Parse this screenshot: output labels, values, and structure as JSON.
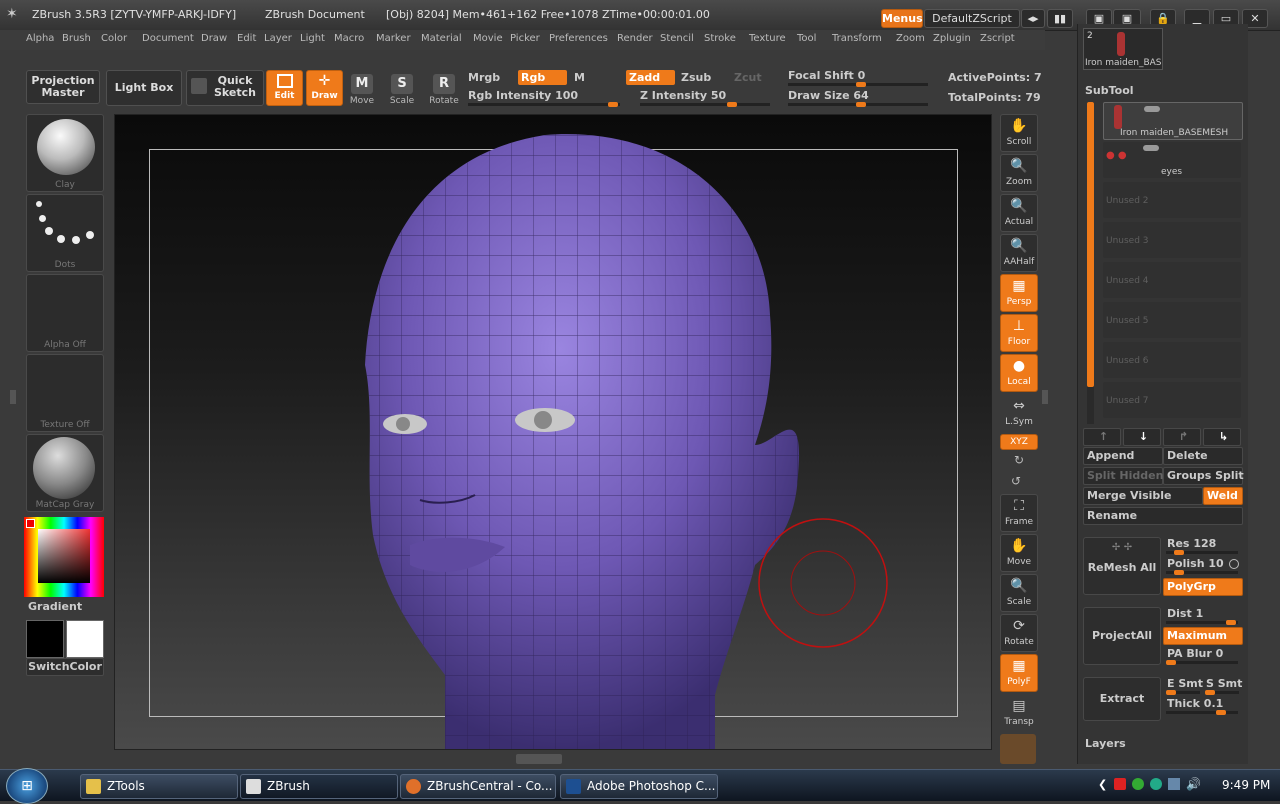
{
  "titlebar": {
    "app": "ZBrush 3.5R3 [ZYTV-YMFP-ARKJ-IDFY]",
    "doc": "ZBrush Document",
    "stats": "[Obj) 8204] Mem•461+162 Free•1078 ZTime•00:00:01.00",
    "menus_btn": "Menus",
    "script_btn": "DefaultZScript"
  },
  "menubar": [
    "Alpha",
    "Brush",
    "Color",
    "Document",
    "Draw",
    "Edit",
    "Layer",
    "Light",
    "Macro",
    "Marker",
    "Material",
    "Movie",
    "Picker",
    "Preferences",
    "Render",
    "Stencil",
    "Stroke",
    "Texture",
    "Tool",
    "Transform",
    "Zoom",
    "Zplugin",
    "Zscript"
  ],
  "toolbar": {
    "projection_master": "Projection Master",
    "light_box": "Light Box",
    "quick_sketch": "Quick Sketch",
    "edit": "Edit",
    "draw": "Draw",
    "move": "Move",
    "scale": "Scale",
    "rotate": "Rotate",
    "mrgb": "Mrgb",
    "rgb": "Rgb",
    "m": "M",
    "zadd": "Zadd",
    "zsub": "Zsub",
    "zcut": "Zcut",
    "rgb_intensity_label": "Rgb Intensity",
    "rgb_intensity": "100",
    "z_intensity_label": "Z Intensity",
    "z_intensity": "50",
    "focal_shift_label": "Focal Shift",
    "focal_shift": "0",
    "draw_size_label": "Draw Size",
    "draw_size": "64",
    "active_points_label": "ActivePoints:",
    "active_points": "7",
    "total_points_label": "TotalPoints:",
    "total_points": "79"
  },
  "leftshelf": {
    "brush": "Clay",
    "stroke": "Dots",
    "alpha": "Alpha Off",
    "texture": "Texture Off",
    "material": "MatCap Gray",
    "gradient": "Gradient",
    "switchcolor": "SwitchColor"
  },
  "rightshelf": [
    "Scroll",
    "Zoom",
    "Actual",
    "AAHalf",
    "Persp",
    "Floor",
    "Local",
    "L.Sym",
    "XYZ",
    "Frame",
    "Move",
    "Scale",
    "Rotate",
    "PolyF",
    "Transp"
  ],
  "toolthumb": {
    "count": "2",
    "name": "Iron maiden_BAS"
  },
  "subtool": {
    "title": "SubTool",
    "items": [
      {
        "name": "Iron maiden_BASEMESH"
      },
      {
        "name": "eyes"
      },
      {
        "name": "Unused 2"
      },
      {
        "name": "Unused 3"
      },
      {
        "name": "Unused 4"
      },
      {
        "name": "Unused 5"
      },
      {
        "name": "Unused 6"
      },
      {
        "name": "Unused 7"
      }
    ],
    "append": "Append",
    "delete": "Delete",
    "split_hidden": "Split Hidden",
    "groups_split": "Groups Split",
    "merge_visible": "Merge Visible",
    "weld": "Weld",
    "rename": "Rename",
    "remesh_all": "ReMesh All",
    "res_label": "Res",
    "res": "128",
    "polish_label": "Polish",
    "polish": "10",
    "polygrp": "PolyGrp",
    "project_all": "ProjectAll",
    "dist_label": "Dist",
    "dist": "1",
    "maximum": "Maximum",
    "pa_blur_label": "PA Blur",
    "pa_blur": "0",
    "extract": "Extract",
    "e_smt": "E Smt",
    "s_smt": "S Smt",
    "thick_label": "Thick",
    "thick": "0.1",
    "layers": "Layers"
  },
  "taskbar": {
    "items": [
      "ZTools",
      "ZBrush",
      "ZBrushCentral - Co...",
      "Adobe Photoshop C..."
    ],
    "clock": "9:49 PM"
  },
  "colors": {
    "accent": "#ef7a1a",
    "mesh": "#7a63c0"
  }
}
